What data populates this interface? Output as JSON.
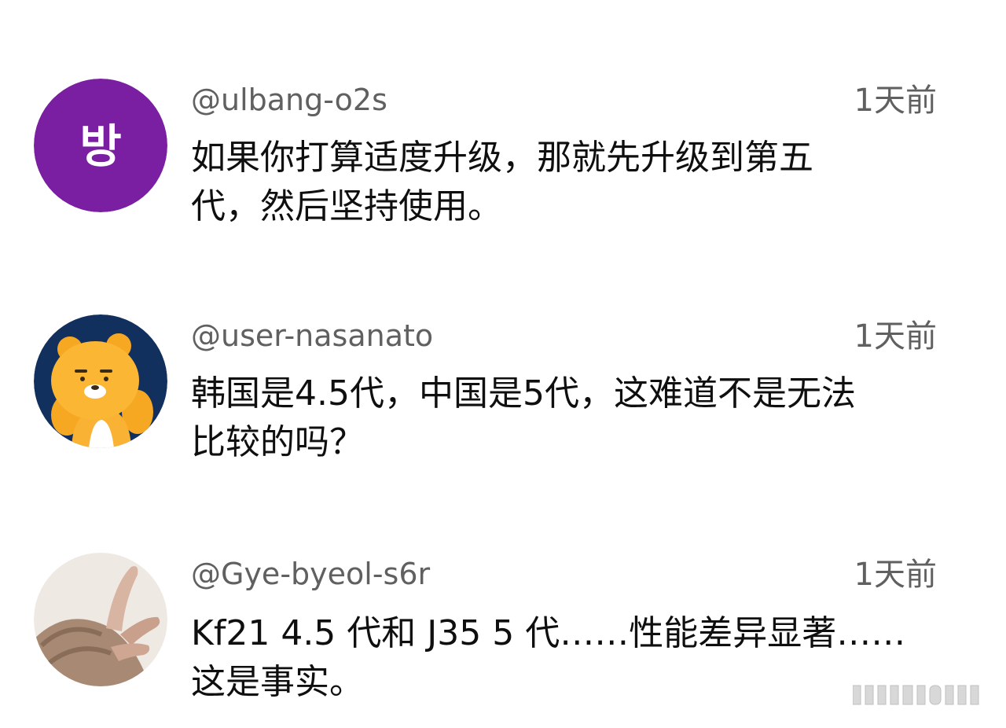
{
  "comments": [
    {
      "author": "@ulbang-o2s",
      "time": "1天前",
      "avatar_text": "방",
      "avatar_color": "#7b1fa2",
      "text": "如果你打算适度升级，那就先升级到第五\n代，然后坚持使用。"
    },
    {
      "author": "@user-nasanato",
      "time": "1天前",
      "avatar_icon": "cartoon-lion-icon",
      "avatar_color": "#12305e",
      "text": "韩国是4.5代，中国是5代，这难道不是无法\n比较的吗？"
    },
    {
      "author": "@Gye-byeol-s6r",
      "time": "1天前",
      "avatar_icon": "finger-heart-hand-icon",
      "avatar_color": "#efe9e4",
      "text": "Kf21 4.5 代和 J35 5 代……性能差异显著……\n这是事实。"
    }
  ],
  "watermark_icon": "barcode-watermark-icon"
}
